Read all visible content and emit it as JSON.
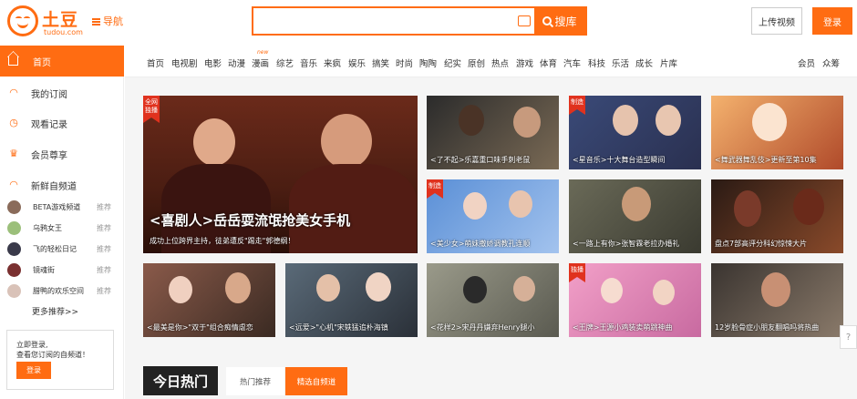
{
  "header": {
    "logo_text": "土豆",
    "logo_sub": "tudou.com",
    "nav_label": "导航",
    "search_placeholder": "",
    "search_button": "搜库",
    "upload_button": "上传视频",
    "login_button": "登录"
  },
  "sidebar": {
    "home": "首页",
    "items": [
      {
        "label": "我的订阅",
        "icon": "rss-icon"
      },
      {
        "label": "观看记录",
        "icon": "clock-icon"
      },
      {
        "label": "会员尊享",
        "icon": "crown-icon"
      },
      {
        "label": "新鲜自频道",
        "icon": "rss-icon"
      }
    ],
    "channels": [
      {
        "label": "BETA游戏频道",
        "tag": "推荐"
      },
      {
        "label": "乌鸦女王",
        "tag": "推荐"
      },
      {
        "label": "飞的轻松日记",
        "tag": "推荐"
      },
      {
        "label": "镜魂街",
        "tag": "推荐"
      },
      {
        "label": "腊鸭的欢乐空间",
        "tag": "推荐"
      }
    ],
    "more": "更多推荐>>",
    "login_prompt": "立即登录,\n查看您订阅的自频道！",
    "login_button": "登录"
  },
  "categories": [
    "首页",
    "电视剧",
    "电影",
    "动漫",
    "漫画",
    "综艺",
    "音乐",
    "来疯",
    "娱乐",
    "搞笑",
    "时尚",
    "陶陶",
    "纪实",
    "原创",
    "热点",
    "游戏",
    "体育",
    "汽车",
    "科技",
    "乐活",
    "成长",
    "片库"
  ],
  "new_badge": "new",
  "right_links": [
    "会员",
    "众筹"
  ],
  "hero": {
    "ribbon": "全网独播",
    "title": "<喜剧人>岳岳耍流氓抢美女手机",
    "subtitle": "成功上位跨界主持，徒弟遭反\"踢走\"郭德纲！"
  },
  "tiles": [
    {
      "caption": "<了不起>乐嘉重口味手刺老鼠",
      "ribbon": ""
    },
    {
      "caption": "<星音乐>十大舞台造型瞬间",
      "ribbon": "制造"
    },
    {
      "caption": "<舞武器舞乱伎>更新至第10集",
      "ribbon": ""
    },
    {
      "caption": "<美少女>萌妹撒娇调教孔连顺",
      "ribbon": "制造"
    },
    {
      "caption": "<一路上有你>张智霖老拉办婚礼",
      "ribbon": ""
    },
    {
      "caption": "盘点7部高评分科幻惊悚大片",
      "ribbon": ""
    },
    {
      "caption": "<最美是你>\"双于\"组合痴情虐恋",
      "ribbon": ""
    },
    {
      "caption": "<远爱>\"心机\"宋轶猛追朴海镇",
      "ribbon": ""
    },
    {
      "caption": "<花样2>宋丹丹嫌弃Henry腿小",
      "ribbon": ""
    },
    {
      "caption": "<王牌>王源小鸡装卖萌跳神曲",
      "ribbon": "独播"
    },
    {
      "caption": "12岁脸骨症小朋友翻唱吗将热曲",
      "ribbon": ""
    }
  ],
  "hot": {
    "title": "今日热门",
    "tab1": "热门推荐",
    "tab2": "精选自频道"
  },
  "help": "?"
}
